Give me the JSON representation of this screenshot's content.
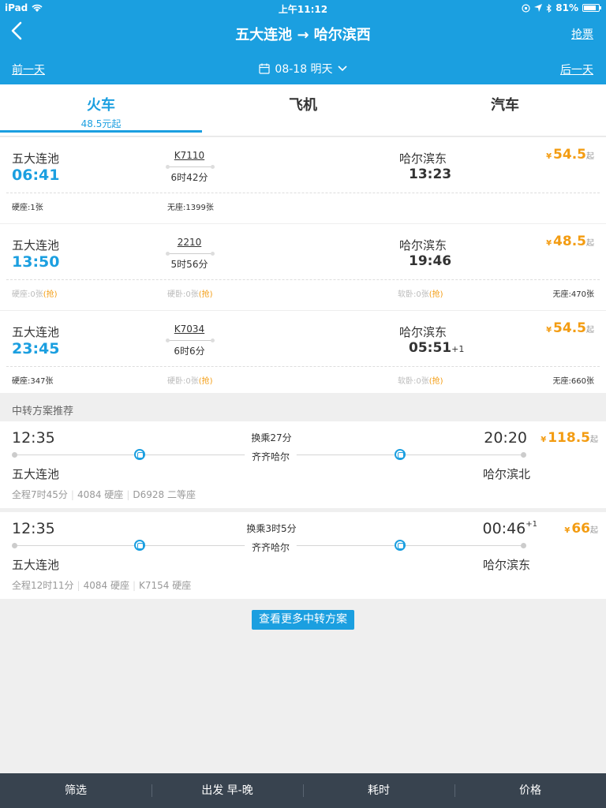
{
  "status_bar": {
    "device": "iPad",
    "time": "上午11:12",
    "battery": "81%",
    "battery_level": 0.81
  },
  "nav": {
    "title": "五大连池 → 哈尔滨西",
    "grab_label": "抢票"
  },
  "date_bar": {
    "prev_label": "前一天",
    "date": "08-18 明天",
    "next_label": "后一天"
  },
  "tabs": [
    {
      "label": "火车",
      "sub": "48.5元起",
      "active": true
    },
    {
      "label": "飞机",
      "sub": "",
      "active": false
    },
    {
      "label": "汽车",
      "sub": "",
      "active": false
    }
  ],
  "trains": [
    {
      "from": "五大连池",
      "dep": "06:41",
      "code": "K7110",
      "duration": "6时42分",
      "to": "哈尔滨东",
      "arr": "13:23",
      "next_day": "",
      "currency": "¥",
      "price": "54.5",
      "price_suffix": "起",
      "seats": [
        {
          "text": "硬座:1张",
          "grab": "",
          "available": true
        },
        {
          "text": "无座:1399张",
          "grab": "",
          "available": true
        }
      ]
    },
    {
      "from": "五大连池",
      "dep": "13:50",
      "code": "2210",
      "duration": "5时56分",
      "to": "哈尔滨东",
      "arr": "19:46",
      "next_day": "",
      "currency": "¥",
      "price": "48.5",
      "price_suffix": "起",
      "seats": [
        {
          "text": "硬座:0张",
          "grab": "(抢)",
          "available": false
        },
        {
          "text": "硬卧:0张",
          "grab": "(抢)",
          "available": false
        },
        {
          "text": "软卧:0张",
          "grab": "(抢)",
          "available": false
        },
        {
          "text": "无座:470张",
          "grab": "",
          "available": true
        }
      ]
    },
    {
      "from": "五大连池",
      "dep": "23:45",
      "code": "K7034",
      "duration": "6时6分",
      "to": "哈尔滨东",
      "arr": "05:51",
      "next_day": "+1",
      "currency": "¥",
      "price": "54.5",
      "price_suffix": "起",
      "seats": [
        {
          "text": "硬座:347张",
          "grab": "",
          "available": true
        },
        {
          "text": "硬卧:0张",
          "grab": "(抢)",
          "available": false
        },
        {
          "text": "软卧:0张",
          "grab": "(抢)",
          "available": false
        },
        {
          "text": "无座:660张",
          "grab": "",
          "available": true
        }
      ]
    }
  ],
  "transfer_section_title": "中转方案推荐",
  "transfers": [
    {
      "dep": "12:35",
      "arr": "20:20",
      "next_day": "",
      "wait": "换乘27分",
      "via": "齐齐哈尔",
      "from": "五大连池",
      "to": "哈尔滨北",
      "currency": "¥",
      "price": "118.5",
      "price_suffix": "起",
      "meta": [
        "全程7时45分",
        "4084 硬座",
        "D6928 二等座"
      ]
    },
    {
      "dep": "12:35",
      "arr": "00:46",
      "next_day": "+1",
      "wait": "换乘3时5分",
      "via": "齐齐哈尔",
      "from": "五大连池",
      "to": "哈尔滨东",
      "currency": "¥",
      "price": "66",
      "price_suffix": "起",
      "meta": [
        "全程12时11分",
        "4084 硬座",
        "K7154 硬座"
      ]
    }
  ],
  "more_button": "查看更多中转方案",
  "bottom_bar": [
    "筛选",
    "出发 早-晚",
    "耗时",
    "价格"
  ]
}
